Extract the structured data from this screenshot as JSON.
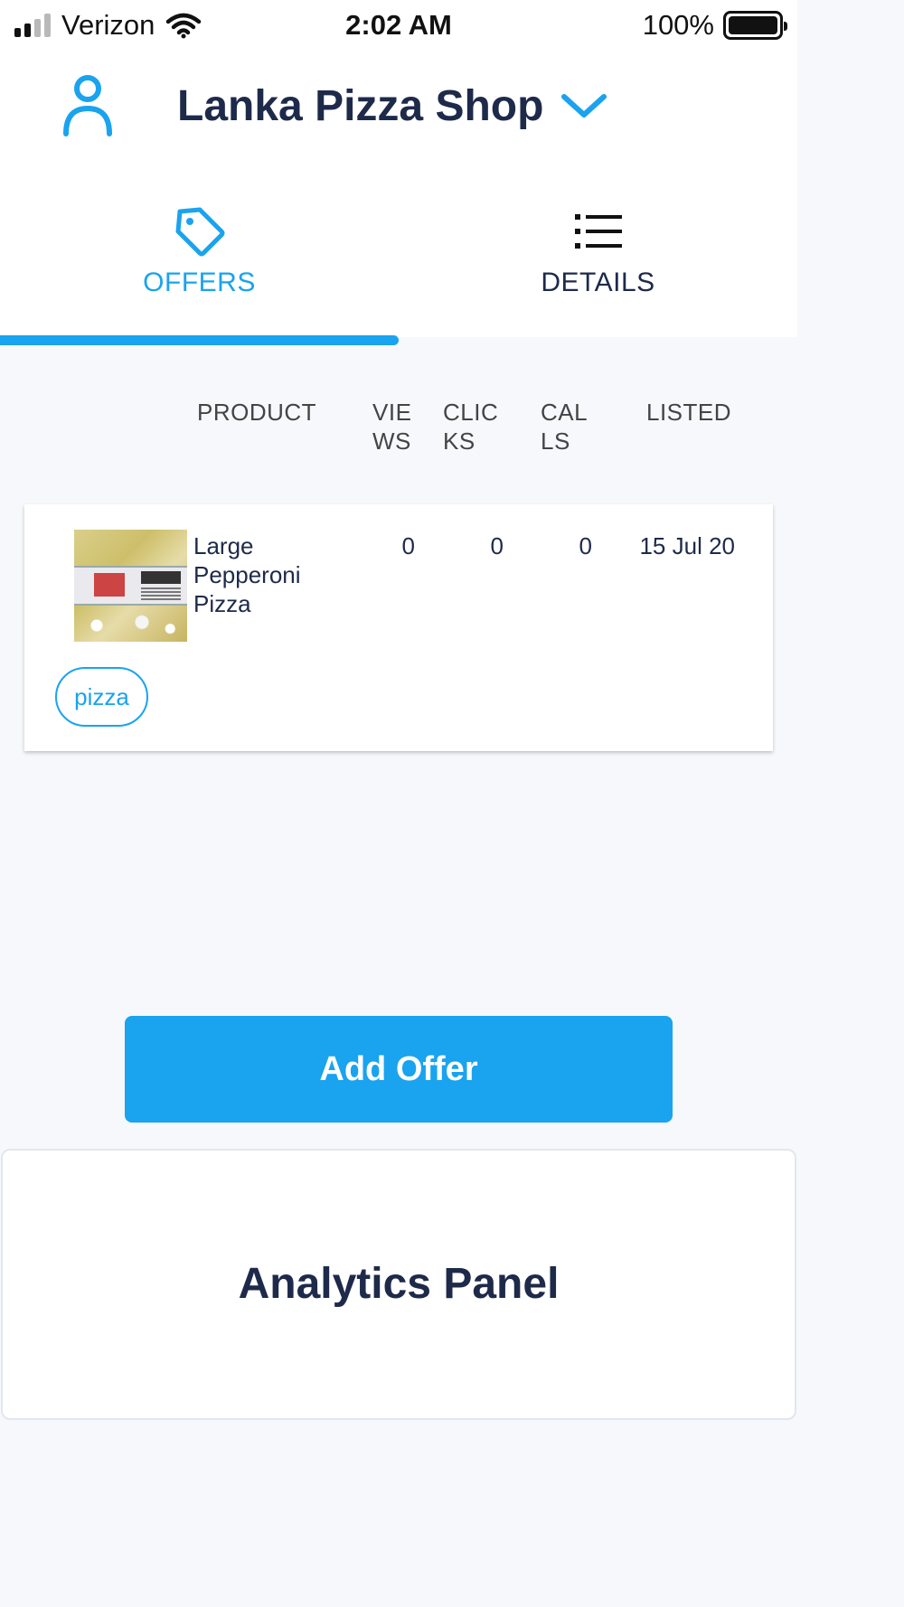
{
  "status_bar": {
    "carrier": "Verizon",
    "time": "2:02 AM",
    "battery_percent": "100%",
    "signal_bars": 2,
    "signal_bars_total": 4,
    "icons": [
      "signal-icon",
      "wifi-icon",
      "battery-icon"
    ]
  },
  "header": {
    "title": "Lanka Pizza Shop",
    "icons": [
      "user-icon",
      "chevron-down-icon"
    ]
  },
  "tabs": [
    {
      "label": "OFFERS",
      "icon": "tag-icon",
      "active": true
    },
    {
      "label": "DETAILS",
      "icon": "list-icon",
      "active": false
    }
  ],
  "table": {
    "headers": {
      "product": "PRODUCT",
      "views": "VIE WS",
      "clicks": "CLIC KS",
      "calls": "CAL LS",
      "listed": "LISTED"
    },
    "rows": [
      {
        "product": "Large Pepperoni Pizza",
        "views": "0",
        "clicks": "0",
        "calls": "0",
        "listed": "15 Jul 20",
        "tag": "pizza"
      }
    ]
  },
  "actions": {
    "add_offer_label": "Add Offer"
  },
  "analytics": {
    "title": "Analytics Panel"
  },
  "colors": {
    "accent": "#1aa3ee",
    "text_dark": "#1e2a4a",
    "background": "#f7f8fb"
  }
}
